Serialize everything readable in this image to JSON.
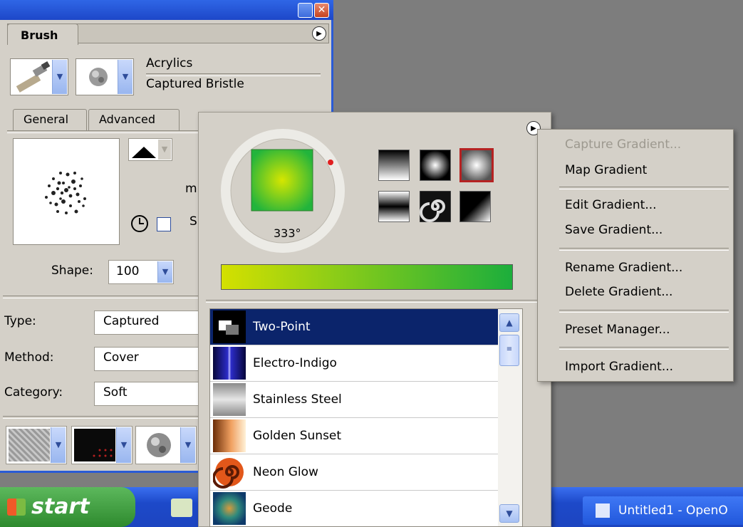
{
  "brush_panel": {
    "tab_label": "Brush",
    "category": "Acrylics",
    "variant": "Captured Bristle",
    "subtabs": [
      "General",
      "Advanced"
    ],
    "shape_label": "Shape:",
    "shape_value": "100",
    "partial_label_1": "m",
    "partial_label_2": "S",
    "type_label": "Type:",
    "type_value": "Captured",
    "method_label": "Method:",
    "method_value": "Cover",
    "category_label": "Category:",
    "category_value": "Soft"
  },
  "gradient_popup": {
    "angle": "333°",
    "gradient_list": [
      {
        "name": "Two-Point",
        "selected": true
      },
      {
        "name": "Electro-Indigo",
        "selected": false
      },
      {
        "name": "Stainless Steel",
        "selected": false
      },
      {
        "name": "Golden Sunset",
        "selected": false
      },
      {
        "name": "Neon Glow",
        "selected": false
      },
      {
        "name": "Geode",
        "selected": false
      }
    ]
  },
  "context_menu": {
    "items": [
      {
        "label": "Capture Gradient...",
        "enabled": false
      },
      {
        "label": "Map Gradient",
        "enabled": true
      },
      {
        "label": "Edit Gradient...",
        "enabled": true
      },
      {
        "label": "Save Gradient...",
        "enabled": true
      },
      {
        "label": "Rename Gradient...",
        "enabled": true
      },
      {
        "label": "Delete Gradient...",
        "enabled": true
      },
      {
        "label": "Preset Manager...",
        "enabled": true
      },
      {
        "label": "Import Gradient...",
        "enabled": true
      }
    ]
  },
  "taskbar": {
    "start_label": "start",
    "task_label": "Untitled1 - OpenO"
  },
  "colors": {
    "selection": "#0b246b",
    "gradient_start": "#d4e000",
    "gradient_end": "#1cae3c",
    "xp_blue": "#2157db"
  }
}
